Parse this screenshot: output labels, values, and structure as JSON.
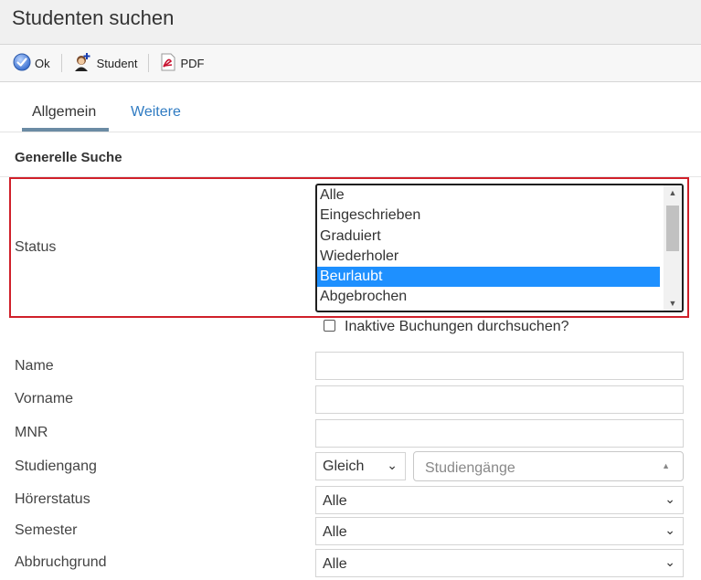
{
  "window": {
    "title": "Studenten suchen"
  },
  "toolbar": {
    "ok_label": "Ok",
    "student_label": "Student",
    "pdf_label": "PDF"
  },
  "tabs": [
    {
      "label": "Allgemein",
      "active": true
    },
    {
      "label": "Weitere",
      "active": false
    }
  ],
  "section": {
    "title": "Generelle Suche"
  },
  "status": {
    "label": "Status",
    "options": [
      "Alle",
      "Eingeschrieben",
      "Graduiert",
      "Wiederholer",
      "Beurlaubt",
      "Abgebrochen"
    ],
    "selected": "Beurlaubt"
  },
  "inactive_checkbox": {
    "label": "Inaktive Buchungen durchsuchen?",
    "checked": false
  },
  "fields": {
    "name_label": "Name",
    "vorname_label": "Vorname",
    "mnr_label": "MNR",
    "studiengang_label": "Studiengang",
    "studiengang_operator": "Gleich",
    "studiengang_placeholder": "Studiengänge",
    "hoererstatus_label": "Hörerstatus",
    "hoererstatus_value": "Alle",
    "semester_label": "Semester",
    "semester_value": "Alle",
    "abbruchgrund_label": "Abbruchgrund",
    "abbruchgrund_value": "Alle"
  },
  "colors": {
    "highlight": "#d0202a",
    "selected_option": "#1e90ff",
    "tab_link": "#2f7bc2",
    "tab_underline": "#6b8ba4"
  }
}
